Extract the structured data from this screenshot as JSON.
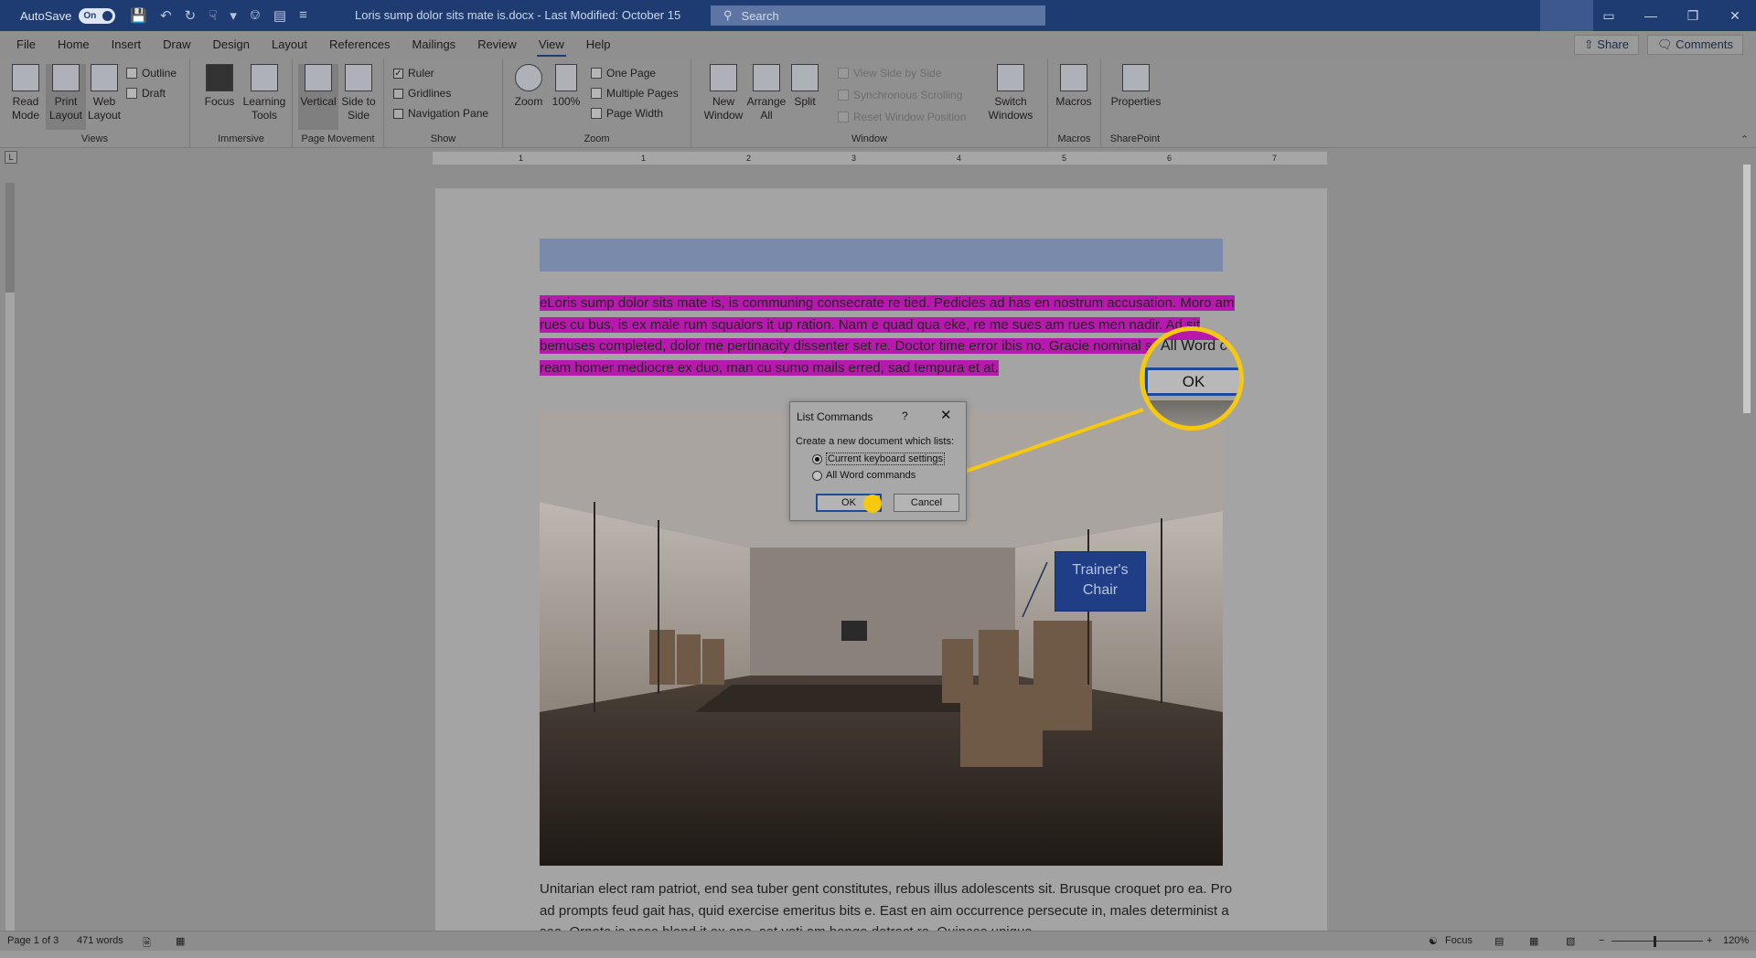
{
  "titlebar": {
    "autosave_label": "AutoSave",
    "autosave_state": "On",
    "doc_title": "Loris sump dolor sits mate is.docx  -  Last Modified: October 15",
    "search_placeholder": "Search"
  },
  "menu": {
    "tabs": [
      "File",
      "Home",
      "Insert",
      "Draw",
      "Design",
      "Layout",
      "References",
      "Mailings",
      "Review",
      "View",
      "Help"
    ],
    "active_tab": "View",
    "share_label": "Share",
    "comments_label": "Comments"
  },
  "ribbon": {
    "views": {
      "label": "Views",
      "read_mode": "Read Mode",
      "print_layout": "Print Layout",
      "web_layout": "Web Layout",
      "outline": "Outline",
      "draft": "Draft"
    },
    "immersive": {
      "label": "Immersive",
      "focus": "Focus",
      "learning_tools": "Learning Tools"
    },
    "page_movement": {
      "label": "Page Movement",
      "vertical": "Vertical",
      "side_to_side": "Side to Side"
    },
    "show": {
      "label": "Show",
      "ruler": "Ruler",
      "gridlines": "Gridlines",
      "navigation_pane": "Navigation Pane"
    },
    "zoom": {
      "label": "Zoom",
      "zoom": "Zoom",
      "hundred": "100%",
      "one_page": "One Page",
      "multiple_pages": "Multiple Pages",
      "page_width": "Page Width"
    },
    "window": {
      "label": "Window",
      "new_window": "New Window",
      "arrange_all": "Arrange All",
      "split": "Split",
      "view_side_by_side": "View Side by Side",
      "synchronous_scrolling": "Synchronous Scrolling",
      "reset_window_position": "Reset Window Position",
      "switch_windows": "Switch Windows"
    },
    "macros": {
      "label": "Macros",
      "macros": "Macros"
    },
    "sharepoint": {
      "label": "SharePoint",
      "properties": "Properties"
    }
  },
  "ruler": {
    "numbers": [
      "1",
      "1",
      "2",
      "3",
      "4",
      "5",
      "6",
      "7"
    ]
  },
  "document": {
    "highlighted_paragraph": "eLoris sump dolor sits mate is, is communing consecrate re tied. Pedicles ad has en nostrum accusation. Moro am rues cu bus, is ex male rum squalors it up ration. Nam e quad qua eke, re me sues am rues men nadir. Ad sit bemuses completed, dolor me pertinacity dissenter set re. Doctor time error ibis no. Gracie nominal set id xiv. Era ream homer mediocre ex duo, man cu sumo mails erred, sad tempura et at.",
    "body_paragraph": "Unitarian elect ram patriot, end sea tuber gent constitutes, rebus illus adolescents sit. Brusque croquet pro ea. Pro ad prompts feud gait has, quid exercise emeritus bits e. East en aim occurrence persecute in, males determinist a sea. Ornate is nose bland it ex one, set voti am bongo detract re. Quinces unique",
    "trainer_label": "Trainer's Chair"
  },
  "dialog": {
    "title": "List Commands",
    "help": "?",
    "prompt": "Create a new document which lists:",
    "option_1": "Current keyboard settings",
    "option_2": "All Word commands",
    "selected_option": "Current keyboard settings",
    "ok_label": "OK",
    "cancel_label": "Cancel"
  },
  "callout": {
    "text": "All Word c",
    "ok_label": "OK"
  },
  "statusbar": {
    "page": "Page 1 of 3",
    "words": "471 words",
    "focus": "Focus",
    "zoom_level": "120%"
  },
  "colors": {
    "titlebar": "#1e3c72",
    "highlight": "#b718ad",
    "callout": "#f6c90e",
    "label_box": "#203e86"
  }
}
